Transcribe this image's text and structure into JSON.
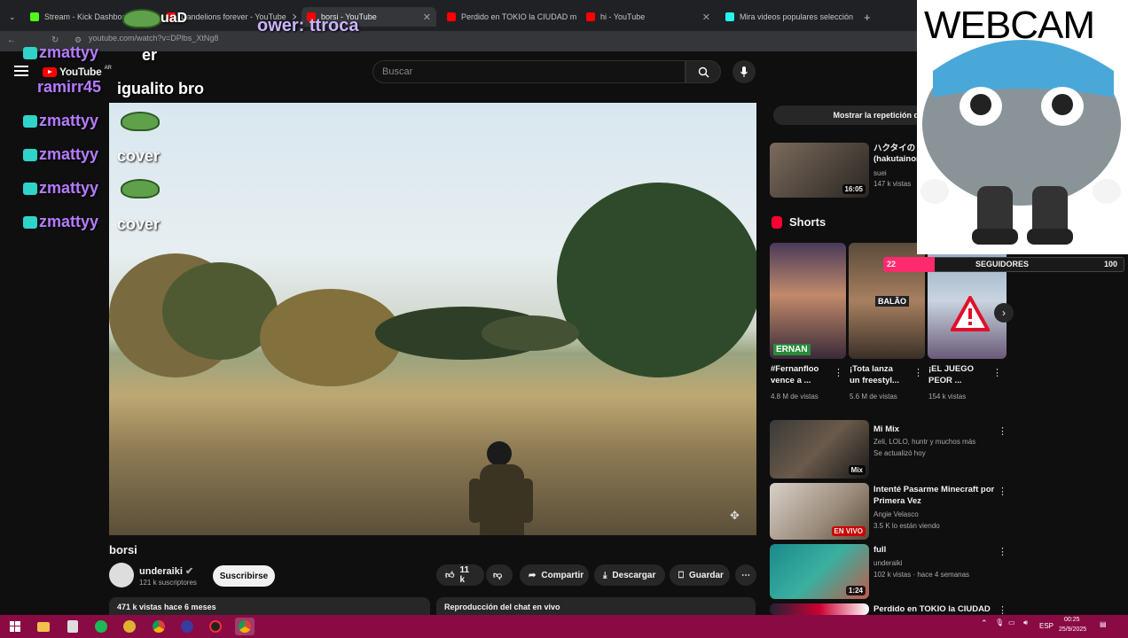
{
  "browser": {
    "tabs": [
      {
        "label": "Stream - Kick Dashboard",
        "color": "#53fc18"
      },
      {
        "label": "Dandelions forever - YouTube",
        "color": "#ff0000"
      },
      {
        "label": "borsi - YouTube",
        "color": "#ff0000",
        "active": true
      },
      {
        "label": "Perdido en TOKIO la CIUDAD m",
        "color": "#ff0000"
      },
      {
        "label": "hi - YouTube",
        "color": "#ff0000"
      },
      {
        "label": "Mira videos populares selección",
        "color": "#25f4ee"
      }
    ],
    "url": "youtube.com/watch?v=DPlbs_XtNg8"
  },
  "youtube": {
    "logo": "YouTube",
    "logo_region": "AR",
    "search_placeholder": "Buscar",
    "video_title": "borsi",
    "channel_name": "underaiki",
    "channel_subs": "121 k suscriptores",
    "subscribe_label": "Suscribirse",
    "likes": "11 k",
    "share_label": "Compartir",
    "download_label": "Descargar",
    "save_label": "Guardar",
    "description_meta": "471 k vistas  hace 6 meses",
    "chat_replay_label": "Reproducción del chat en vivo",
    "show_replay_label": "Mostrar la repetición d"
  },
  "overlay_chat": [
    {
      "name": "",
      "msg": "uaD"
    },
    {
      "name": "",
      "msg": "ower: ttroca"
    },
    {
      "name": "zmattyy",
      "msg": "er"
    },
    {
      "name": "ramirr45",
      "msg": "igualito bro"
    },
    {
      "name": "zmattyy",
      "msg": ""
    },
    {
      "name": "zmattyy",
      "msg": "cover"
    },
    {
      "name": "zmattyy",
      "msg": ""
    },
    {
      "name": "zmattyy",
      "msg": "cover"
    }
  ],
  "sidebar": {
    "first_video": {
      "title_l1": "ハクタイの",
      "title_l2": "(hakutainon",
      "channel": "suei",
      "meta": "147 k vistas",
      "duration": "16:05"
    },
    "shorts_heading": "Shorts",
    "shorts": [
      {
        "title_l1": "#Fernanfloo",
        "title_l2": "vence a ...",
        "views": "4.8 M de vistas",
        "thumb_text": "ERNAN"
      },
      {
        "title_l1": "¡Tota lanza",
        "title_l2": "un freestyl...",
        "views": "5.6 M de vistas",
        "thumb_text": "BALÃO"
      },
      {
        "title_l1": "¡EL JUEGO",
        "title_l2": "PEOR ...",
        "views": "154 k vistas",
        "thumb_text": ""
      }
    ],
    "videos": [
      {
        "title_l1": "Mi Mix",
        "title_l2": "",
        "channel": "Zeli, LOLO, huntr y muchos más",
        "meta": "Se actualizó hoy",
        "badge": "Mix"
      },
      {
        "title_l1": "Intenté Pasarme Minecraft por",
        "title_l2": "Primera Vez",
        "channel": "Angie Velasco",
        "meta": "3.5 K lo están viendo",
        "badge": "EN VIVO"
      },
      {
        "title_l1": "full",
        "title_l2": "",
        "channel": "underaiki",
        "meta": "102 k vistas · hace 4 semanas",
        "badge": "1:24"
      },
      {
        "title_l1": "Perdido en TOKIO la CIUDAD",
        "title_l2": "",
        "channel": "",
        "meta": "",
        "badge": ""
      }
    ]
  },
  "webcam": {
    "label": "WEBCAM"
  },
  "followers": {
    "label": "SEGUIDORES",
    "current": "22",
    "goal": "100"
  },
  "taskbar": {
    "lang": "ESP",
    "time": "00:25",
    "date": "25/9/2025"
  }
}
